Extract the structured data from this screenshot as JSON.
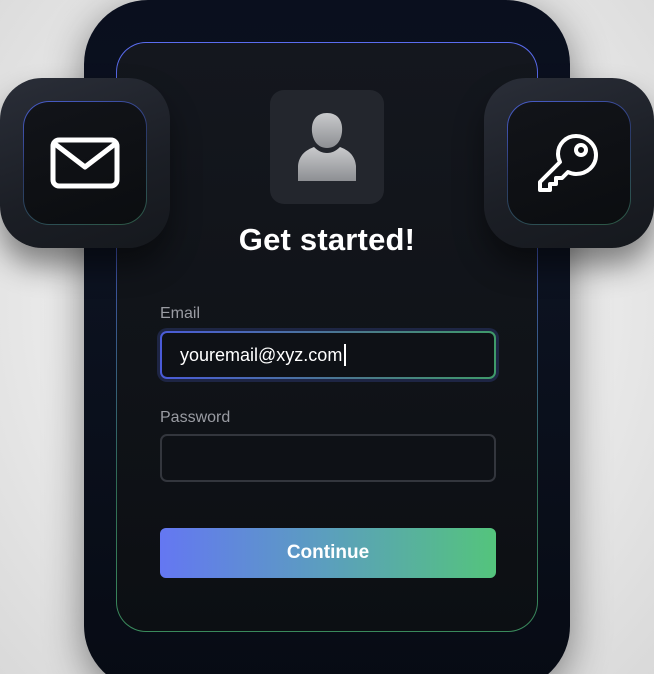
{
  "form": {
    "title": "Get started!",
    "email_label": "Email",
    "email_value": "youremail@xyz.com",
    "password_label": "Password",
    "password_value": "",
    "continue_label": "Continue"
  },
  "icons": {
    "avatar": "user-icon",
    "left_tile": "envelope-icon",
    "right_tile": "key-icon"
  },
  "colors": {
    "gradient_start": "#6477f2",
    "gradient_end": "#54c47c"
  }
}
